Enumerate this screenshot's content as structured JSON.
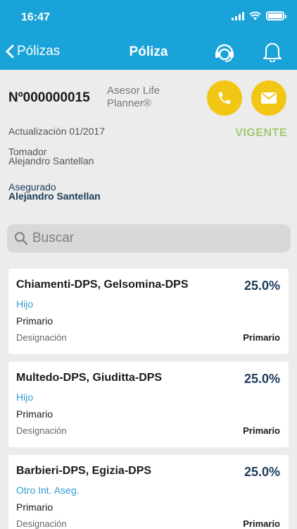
{
  "status_bar": {
    "time": "16:47"
  },
  "nav": {
    "back_label": "Pólizas",
    "title": "Póliza"
  },
  "policy": {
    "number": "Nº000000015",
    "advisor": "Asesor Life Planner®",
    "update": "Actualización 01/2017",
    "status": "VIGENTE",
    "holder_label": "Tomador",
    "holder_name": "Alejandro Santellan",
    "insured_label": "Asegurado",
    "insured_name": "Alejandro Santellan"
  },
  "search": {
    "placeholder": "Buscar"
  },
  "beneficiaries": [
    {
      "name": "Chiamenti-DPS, Gelsomina-DPS",
      "percent": "25.0%",
      "relation": "Hijo",
      "type": "Primario",
      "designation_label": "Designación",
      "designation_value": "Primario"
    },
    {
      "name": "Multedo-DPS, Giuditta-DPS",
      "percent": "25.0%",
      "relation": "Hijo",
      "type": "Primario",
      "designation_label": "Designación",
      "designation_value": "Primario"
    },
    {
      "name": "Barbieri-DPS, Egizia-DPS",
      "percent": "25.0%",
      "relation": "Otro Int. Aseg.",
      "type": "Primario",
      "designation_label": "Designación",
      "designation_value": "Primario"
    }
  ],
  "colors": {
    "header": "#1aa3d9",
    "accent_button": "#f2c614",
    "status_active": "#a3c873",
    "relation_text": "#2f9bd1"
  }
}
